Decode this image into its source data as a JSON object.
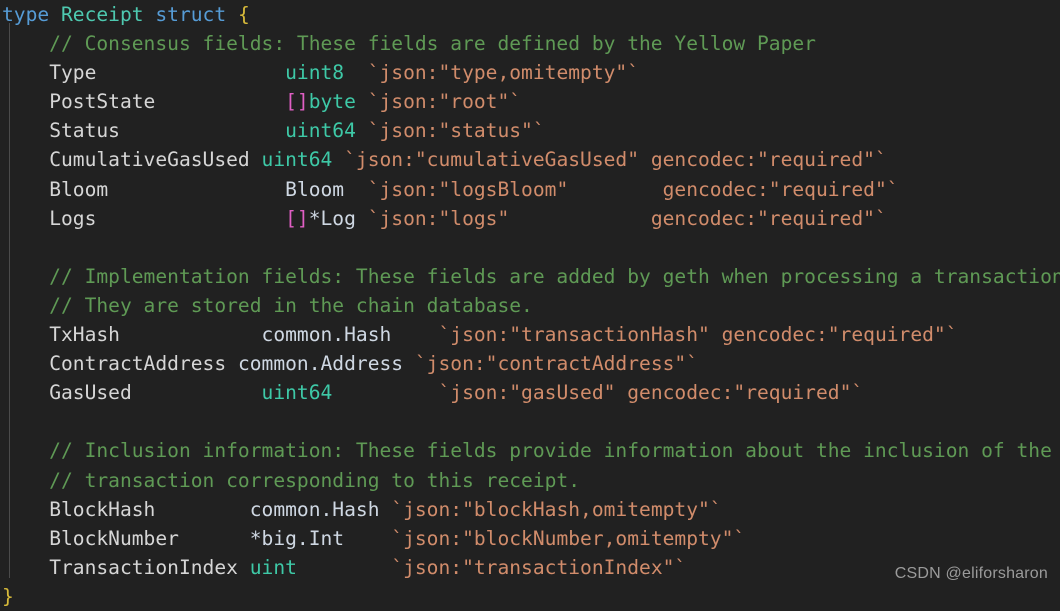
{
  "editor": {
    "language": "go",
    "theme": "dark-plus",
    "background_color": "#212121",
    "watermark": "CSDN @eliforsharon",
    "colors": {
      "keyword": "#569cd6",
      "type_name": "#4ec9b0",
      "brace": "#d7ba3a",
      "comment": "#5f9a55",
      "identifier": "#d6d6d6",
      "builtin_type": "#3ec9a7",
      "punctuation": "#e05fc4",
      "struct_type": "#cfd8e3",
      "string_tag": "#d18c6b"
    }
  },
  "code_lines": [
    [
      {
        "t": "type",
        "c": "kw"
      },
      {
        "t": " ",
        "c": "plain"
      },
      {
        "t": "Receipt",
        "c": "typename"
      },
      {
        "t": " ",
        "c": "plain"
      },
      {
        "t": "struct",
        "c": "kw"
      },
      {
        "t": " ",
        "c": "plain"
      },
      {
        "t": "{",
        "c": "brace"
      }
    ],
    [
      {
        "t": "    // Consensus fields: These fields are defined by the Yellow Paper",
        "c": "comment"
      }
    ],
    [
      {
        "t": "    ",
        "c": "plain"
      },
      {
        "t": "Type                ",
        "c": "ident"
      },
      {
        "t": "uint8",
        "c": "builtin"
      },
      {
        "t": "  ",
        "c": "plain"
      },
      {
        "t": "`json:\"type,omitempty\"`",
        "c": "tag"
      }
    ],
    [
      {
        "t": "    ",
        "c": "plain"
      },
      {
        "t": "PostState           ",
        "c": "ident"
      },
      {
        "t": "[]",
        "c": "punct"
      },
      {
        "t": "byte",
        "c": "builtin"
      },
      {
        "t": " ",
        "c": "plain"
      },
      {
        "t": "`json:\"root\"`",
        "c": "tag"
      }
    ],
    [
      {
        "t": "    ",
        "c": "plain"
      },
      {
        "t": "Status              ",
        "c": "ident"
      },
      {
        "t": "uint64",
        "c": "builtin"
      },
      {
        "t": " ",
        "c": "plain"
      },
      {
        "t": "`json:\"status\"`",
        "c": "tag"
      }
    ],
    [
      {
        "t": "    ",
        "c": "plain"
      },
      {
        "t": "CumulativeGasUsed ",
        "c": "ident"
      },
      {
        "t": "uint64",
        "c": "builtin"
      },
      {
        "t": " ",
        "c": "plain"
      },
      {
        "t": "`json:\"cumulativeGasUsed\" gencodec:\"required\"`",
        "c": "tag"
      }
    ],
    [
      {
        "t": "    ",
        "c": "plain"
      },
      {
        "t": "Bloom               ",
        "c": "ident"
      },
      {
        "t": "Bloom",
        "c": "struct"
      },
      {
        "t": "  ",
        "c": "plain"
      },
      {
        "t": "`json:\"logsBloom\"        gencodec:\"required\"`",
        "c": "tag"
      }
    ],
    [
      {
        "t": "    ",
        "c": "plain"
      },
      {
        "t": "Logs                ",
        "c": "ident"
      },
      {
        "t": "[]",
        "c": "punct"
      },
      {
        "t": "*Log",
        "c": "struct"
      },
      {
        "t": " ",
        "c": "plain"
      },
      {
        "t": "`json:\"logs\"            gencodec:\"required\"`",
        "c": "tag"
      }
    ],
    [
      {
        "t": "",
        "c": "plain"
      }
    ],
    [
      {
        "t": "    // Implementation fields: These fields are added by geth when processing a transaction.",
        "c": "comment"
      }
    ],
    [
      {
        "t": "    // They are stored in the chain database.",
        "c": "comment"
      }
    ],
    [
      {
        "t": "    ",
        "c": "plain"
      },
      {
        "t": "TxHash            ",
        "c": "ident"
      },
      {
        "t": "common.Hash",
        "c": "struct"
      },
      {
        "t": "    ",
        "c": "plain"
      },
      {
        "t": "`json:\"transactionHash\" gencodec:\"required\"`",
        "c": "tag"
      }
    ],
    [
      {
        "t": "    ",
        "c": "plain"
      },
      {
        "t": "ContractAddress ",
        "c": "ident"
      },
      {
        "t": "common.Address",
        "c": "struct"
      },
      {
        "t": " ",
        "c": "plain"
      },
      {
        "t": "`json:\"contractAddress\"`",
        "c": "tag"
      }
    ],
    [
      {
        "t": "    ",
        "c": "plain"
      },
      {
        "t": "GasUsed           ",
        "c": "ident"
      },
      {
        "t": "uint64",
        "c": "builtin"
      },
      {
        "t": "         ",
        "c": "plain"
      },
      {
        "t": "`json:\"gasUsed\" gencodec:\"required\"`",
        "c": "tag"
      }
    ],
    [
      {
        "t": "",
        "c": "plain"
      }
    ],
    [
      {
        "t": "    // Inclusion information: These fields provide information about the inclusion of the",
        "c": "comment"
      }
    ],
    [
      {
        "t": "    // transaction corresponding to this receipt.",
        "c": "comment"
      }
    ],
    [
      {
        "t": "    ",
        "c": "plain"
      },
      {
        "t": "BlockHash        ",
        "c": "ident"
      },
      {
        "t": "common.Hash",
        "c": "struct"
      },
      {
        "t": " ",
        "c": "plain"
      },
      {
        "t": "`json:\"blockHash,omitempty\"`",
        "c": "tag"
      }
    ],
    [
      {
        "t": "    ",
        "c": "plain"
      },
      {
        "t": "BlockNumber      ",
        "c": "ident"
      },
      {
        "t": "*big.Int",
        "c": "struct"
      },
      {
        "t": "    ",
        "c": "plain"
      },
      {
        "t": "`json:\"blockNumber,omitempty\"`",
        "c": "tag"
      }
    ],
    [
      {
        "t": "    ",
        "c": "plain"
      },
      {
        "t": "TransactionIndex ",
        "c": "ident"
      },
      {
        "t": "uint",
        "c": "builtin"
      },
      {
        "t": "        ",
        "c": "plain"
      },
      {
        "t": "`json:\"transactionIndex\"`",
        "c": "tag"
      }
    ],
    [
      {
        "t": "}",
        "c": "brace"
      }
    ]
  ],
  "struct_info": {
    "name": "Receipt",
    "keyword": "type",
    "kind": "struct",
    "fields": [
      {
        "name": "Type",
        "type": "uint8",
        "tag": "`json:\"type,omitempty\"`",
        "group": "consensus"
      },
      {
        "name": "PostState",
        "type": "[]byte",
        "tag": "`json:\"root\"`",
        "group": "consensus"
      },
      {
        "name": "Status",
        "type": "uint64",
        "tag": "`json:\"status\"`",
        "group": "consensus"
      },
      {
        "name": "CumulativeGasUsed",
        "type": "uint64",
        "tag": "`json:\"cumulativeGasUsed\" gencodec:\"required\"`",
        "group": "consensus"
      },
      {
        "name": "Bloom",
        "type": "Bloom",
        "tag": "`json:\"logsBloom\" gencodec:\"required\"`",
        "group": "consensus"
      },
      {
        "name": "Logs",
        "type": "[]*Log",
        "tag": "`json:\"logs\" gencodec:\"required\"`",
        "group": "consensus"
      },
      {
        "name": "TxHash",
        "type": "common.Hash",
        "tag": "`json:\"transactionHash\" gencodec:\"required\"`",
        "group": "implementation"
      },
      {
        "name": "ContractAddress",
        "type": "common.Address",
        "tag": "`json:\"contractAddress\"`",
        "group": "implementation"
      },
      {
        "name": "GasUsed",
        "type": "uint64",
        "tag": "`json:\"gasUsed\" gencodec:\"required\"`",
        "group": "implementation"
      },
      {
        "name": "BlockHash",
        "type": "common.Hash",
        "tag": "`json:\"blockHash,omitempty\"`",
        "group": "inclusion"
      },
      {
        "name": "BlockNumber",
        "type": "*big.Int",
        "tag": "`json:\"blockNumber,omitempty\"`",
        "group": "inclusion"
      },
      {
        "name": "TransactionIndex",
        "type": "uint",
        "tag": "`json:\"transactionIndex\"`",
        "group": "inclusion"
      }
    ],
    "comments": [
      "// Consensus fields: These fields are defined by the Yellow Paper",
      "// Implementation fields: These fields are added by geth when processing a transaction.",
      "// They are stored in the chain database.",
      "// Inclusion information: These fields provide information about the inclusion of the",
      "// transaction corresponding to this receipt."
    ]
  }
}
